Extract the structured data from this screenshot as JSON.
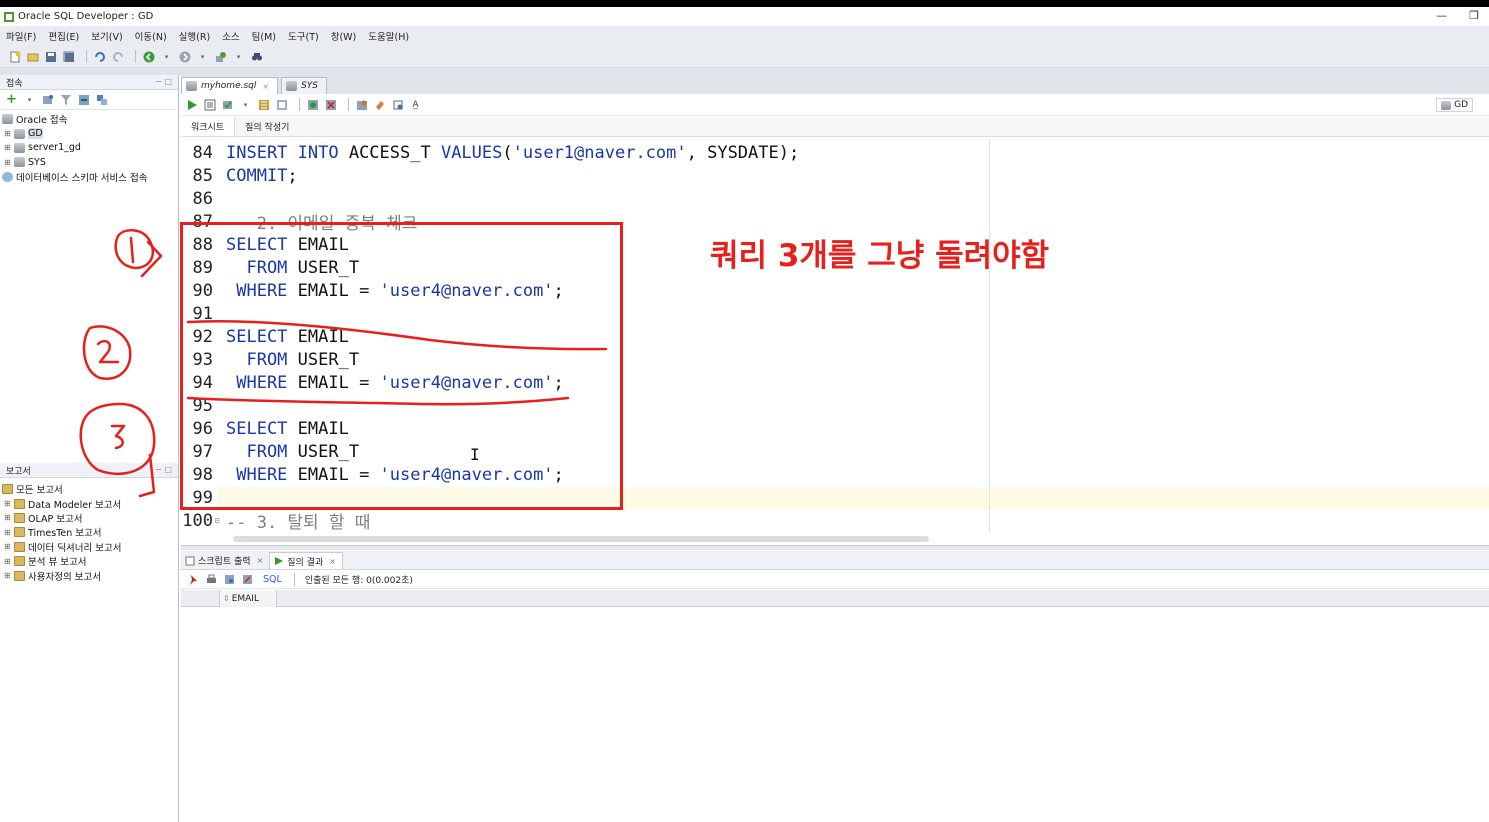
{
  "window": {
    "title": "Oracle SQL Developer : GD",
    "minimize": "—",
    "restore": "❐"
  },
  "menu": [
    "파일(F)",
    "편집(E)",
    "보기(V)",
    "이동(N)",
    "실행(R)",
    "소스",
    "팀(M)",
    "도구(T)",
    "창(W)",
    "도움말(H)"
  ],
  "connections_panel": {
    "title": "접속",
    "items": [
      {
        "label": "Oracle 접속",
        "icon": "database-folder-icon"
      },
      {
        "label": "GD",
        "icon": "connection-icon"
      },
      {
        "label": "server1_gd",
        "icon": "connection-icon"
      },
      {
        "label": "SYS",
        "icon": "connection-icon"
      },
      {
        "label": "데이터베이스 스키마 서비스 접속",
        "icon": "cloud-icon"
      }
    ]
  },
  "reports_panel": {
    "title": "보고서",
    "items": [
      {
        "label": "모든 보고서"
      },
      {
        "label": "Data Modeler 보고서"
      },
      {
        "label": "OLAP 보고서"
      },
      {
        "label": "TimesTen 보고서"
      },
      {
        "label": "데이터 딕셔너리 보고서"
      },
      {
        "label": "분석 뷰 보고서"
      },
      {
        "label": "사용자정의 보고서"
      }
    ]
  },
  "editor_tabs": [
    {
      "label": "myhome.sql",
      "active": true
    },
    {
      "label": "SYS",
      "active": false
    }
  ],
  "connection_selector": "GD",
  "sub_tabs": [
    "워크시트",
    "질의 작성기"
  ],
  "code_lines": [
    {
      "n": "84",
      "tokens": [
        {
          "t": "INSERT INTO",
          "c": "kw"
        },
        {
          "t": " ACCESS_T ",
          "c": ""
        },
        {
          "t": "VALUES",
          "c": "kw"
        },
        {
          "t": "(",
          "c": ""
        },
        {
          "t": "'user1@naver.com'",
          "c": "str"
        },
        {
          "t": ", SYSDATE);",
          "c": ""
        }
      ]
    },
    {
      "n": "85",
      "tokens": [
        {
          "t": "COMMIT",
          "c": "kw"
        },
        {
          "t": ";",
          "c": ""
        }
      ]
    },
    {
      "n": "86",
      "tokens": []
    },
    {
      "n": "87",
      "tokens": [
        {
          "t": "-- 2. 이메일 중복 체크",
          "c": "cm"
        }
      ]
    },
    {
      "n": "88",
      "tokens": [
        {
          "t": "SELECT",
          "c": "kw"
        },
        {
          "t": " EMAIL",
          "c": ""
        }
      ]
    },
    {
      "n": "89",
      "tokens": [
        {
          "t": "  FROM",
          "c": "kw"
        },
        {
          "t": " USER_T",
          "c": ""
        }
      ]
    },
    {
      "n": "90",
      "tokens": [
        {
          "t": " WHERE",
          "c": "kw"
        },
        {
          "t": " EMAIL = ",
          "c": ""
        },
        {
          "t": "'user4@naver.com'",
          "c": "str"
        },
        {
          "t": ";",
          "c": ""
        }
      ]
    },
    {
      "n": "91",
      "tokens": []
    },
    {
      "n": "92",
      "tokens": [
        {
          "t": "SELECT",
          "c": "kw"
        },
        {
          "t": " EMAIL",
          "c": ""
        }
      ]
    },
    {
      "n": "93",
      "tokens": [
        {
          "t": "  FROM",
          "c": "kw"
        },
        {
          "t": " USER_T",
          "c": ""
        }
      ]
    },
    {
      "n": "94",
      "tokens": [
        {
          "t": " WHERE",
          "c": "kw"
        },
        {
          "t": " EMAIL = ",
          "c": ""
        },
        {
          "t": "'user4@naver.com'",
          "c": "str"
        },
        {
          "t": ";",
          "c": ""
        }
      ]
    },
    {
      "n": "95",
      "tokens": []
    },
    {
      "n": "96",
      "tokens": [
        {
          "t": "SELECT",
          "c": "kw"
        },
        {
          "t": " EMAIL",
          "c": ""
        }
      ]
    },
    {
      "n": "97",
      "tokens": [
        {
          "t": "  FROM",
          "c": "kw"
        },
        {
          "t": " USER_T",
          "c": ""
        }
      ]
    },
    {
      "n": "98",
      "tokens": [
        {
          "t": " WHERE",
          "c": "kw"
        },
        {
          "t": " EMAIL = ",
          "c": ""
        },
        {
          "t": "'user4@naver.com'",
          "c": "str"
        },
        {
          "t": ";",
          "c": ""
        }
      ]
    },
    {
      "n": "99",
      "tokens": []
    },
    {
      "n": "100",
      "tokens": [
        {
          "t": "-- 3. 탈퇴 할 때",
          "c": "cm"
        }
      ],
      "fold": "⊟"
    }
  ],
  "output_tabs": [
    {
      "label": "스크립트 출력",
      "active": false
    },
    {
      "label": "질의 결과",
      "active": true
    }
  ],
  "output_toolbar": {
    "sql_link": "SQL",
    "status": "인출된 모든 행: 0(0.002초)"
  },
  "result_columns": [
    "EMAIL"
  ],
  "annotation": {
    "text": "쿼리 3개를 그냥 돌려야함",
    "color": "#e8201c",
    "markers": [
      "1",
      "2",
      "3"
    ]
  },
  "colors": {
    "keyword": "#1a37a8",
    "string": "#1a37a8",
    "comment": "#7f7f7f",
    "annotation_red": "#e8201c"
  }
}
